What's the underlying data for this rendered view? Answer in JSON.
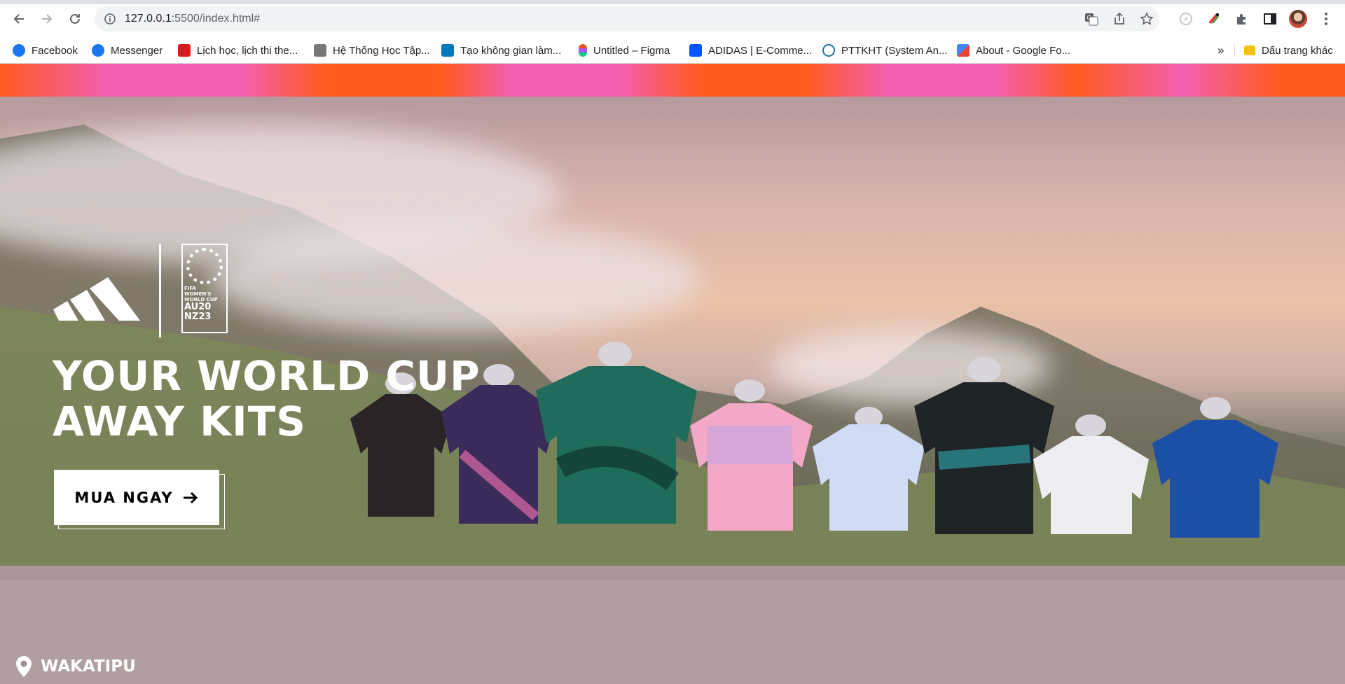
{
  "browser": {
    "url_host": "127.0.0.1",
    "url_rest": ":5500/index.html#",
    "icons": [
      "back-arrow-icon",
      "forward-arrow-icon",
      "reload-icon",
      "info-icon",
      "translate-icon",
      "share-icon",
      "star-icon",
      "compass-icon",
      "colorful-extension-icon",
      "puzzle-icon",
      "sidebar-icon",
      "avatar",
      "menu-dots-icon"
    ]
  },
  "bookmarks": [
    {
      "label": "Facebook",
      "color": "#1877f2"
    },
    {
      "label": "Messenger",
      "color": "#1877f2"
    },
    {
      "label": "Lịch học, lịch thi the...",
      "color": "#d71920"
    },
    {
      "label": "Hệ Thống Học Tập...",
      "color": "#777777"
    },
    {
      "label": "Tạo không gian làm...",
      "color": "#0079bf"
    },
    {
      "label": "Untitled – Figma",
      "color": "#f24e1e"
    },
    {
      "label": "ADIDAS | E-Comme...",
      "color": "#0057ff"
    },
    {
      "label": "PTTKHT (System An...",
      "color": "#21759b"
    },
    {
      "label": "About - Google Fo...",
      "color": "#ea4335"
    },
    {
      "label": "»",
      "color": ""
    },
    {
      "label": "Dấu trang khác",
      "color": "#f4c20d"
    }
  ],
  "hero": {
    "title_line1": "YOUR WORLD CUP",
    "title_line2": "AWAY KITS",
    "cta_label": "MUA NGAY",
    "location": "WAKATIPU",
    "logo_fifa_text": [
      "FIFA",
      "WOMEN'S",
      "WORLD CUP",
      "AU",
      "NZ",
      "20",
      "23"
    ],
    "colors": {
      "promo_orange": "#ff5a1f",
      "promo_pink": "#f25fb0"
    }
  }
}
